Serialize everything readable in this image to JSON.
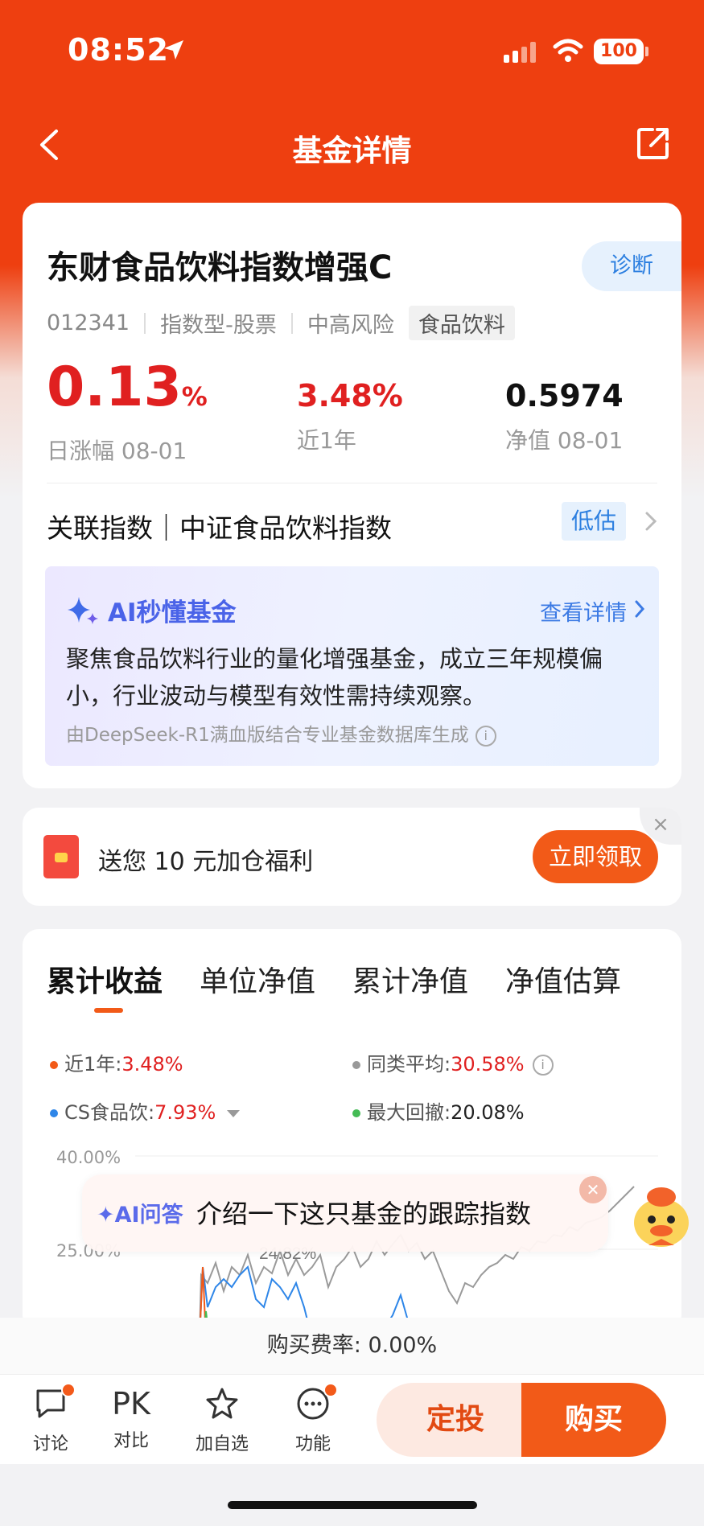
{
  "status_bar": {
    "time": "08:52",
    "battery": "100"
  },
  "nav": {
    "title": "基金详情"
  },
  "fund": {
    "name": "东财食品饮料指数增强C",
    "diagnose_label": "诊断",
    "code": "012341",
    "type": "指数型-股票",
    "risk": "中高风险",
    "sector_tag": "食品饮料",
    "daily_change_value": "0.13",
    "daily_change_unit": "%",
    "daily_change_label": "日涨幅 08-01",
    "one_year_value": "3.48%",
    "one_year_label": "近1年",
    "nav_value": "0.5974",
    "nav_label": "净值 08-01",
    "related_index": "关联指数｜中证食品饮料指数",
    "valuation_badge": "低估"
  },
  "ai_summary": {
    "title": "AI秒懂基金",
    "more_label": "查看详情",
    "text": "聚焦食品饮料行业的量化增强基金，成立三年规模偏小，行业波动与模型有效性需持续观察。",
    "footer": "由DeepSeek-R1满血版结合专业基金数据库生成"
  },
  "promo": {
    "text": "送您 10 元加仓福利",
    "button_label": "立即领取",
    "close": "×"
  },
  "performance": {
    "tabs": [
      "累计收益",
      "单位净值",
      "累计净值",
      "净值估算"
    ],
    "active_tab": 0,
    "legend": [
      {
        "label": "近1年:",
        "value": "3.48%",
        "color": "#f25a18"
      },
      {
        "label": "同类平均:",
        "value": "30.58%",
        "color": "#999999"
      },
      {
        "label": "CS食品饮:",
        "value": "7.93%",
        "color": "#2e86e8"
      },
      {
        "label": "最大回撤:",
        "value": "20.08%",
        "color": "#44bb55"
      }
    ],
    "y_ticks": [
      "40.00%",
      "25.00%"
    ],
    "annotation": "24.82%"
  },
  "chart_data": {
    "type": "line",
    "title": "",
    "ylim": [
      0,
      40
    ],
    "y_ticks": [
      "40.00%",
      "25.00%"
    ],
    "series": [
      {
        "name": "近1年",
        "color": "#f25a18",
        "values": [
          3.48
        ]
      },
      {
        "name": "同类平均",
        "color": "#999999",
        "values": [
          30.58
        ]
      },
      {
        "name": "CS食品饮",
        "color": "#2e86e8",
        "values": [
          7.93
        ]
      }
    ],
    "max_drawdown": "20.08%"
  },
  "ai_question": {
    "label": "AI问答",
    "question": "介绍一下这只基金的跟踪指数"
  },
  "fee": {
    "text": "购买费率: 0.00%"
  },
  "bottom_bar": {
    "discuss": "讨论",
    "pk_icon": "PK",
    "compare": "对比",
    "watch": "加自选",
    "function": "功能",
    "fixed_invest": "定投",
    "buy": "购买"
  }
}
